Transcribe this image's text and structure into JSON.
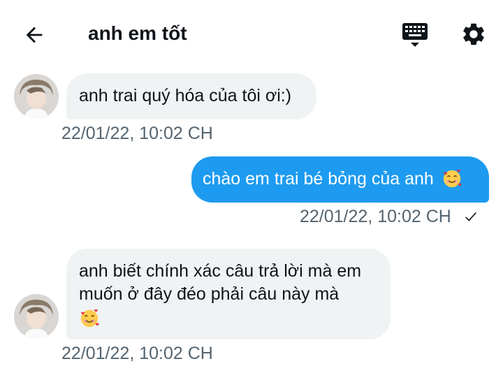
{
  "header": {
    "title": "anh em tốt",
    "back_icon": "arrow-left-icon",
    "keyboard_icon": "keyboard-icon",
    "settings_icon": "gear-icon"
  },
  "messages": [
    {
      "direction": "incoming",
      "text": "anh trai quý hóa của tôi ơi:)",
      "timestamp": "22/01/22, 10:02 CH"
    },
    {
      "direction": "outgoing",
      "text": "chào em trai bé bỏng của anh",
      "emoji": "smiling-face-with-hearts",
      "timestamp": "22/01/22, 10:02 CH",
      "status_icon": "check-icon"
    },
    {
      "direction": "incoming",
      "text": "anh biết chính xác câu trả lời mà em muốn ở đây đéo phải câu này mà",
      "emoji": "smiling-face-with-hearts",
      "timestamp": "22/01/22, 10:02 CH"
    }
  ],
  "colors": {
    "outgoing_bubble": "#1d9bf0",
    "incoming_bubble": "#eff3f4",
    "timestamp": "#536471",
    "text": "#0f1419"
  }
}
